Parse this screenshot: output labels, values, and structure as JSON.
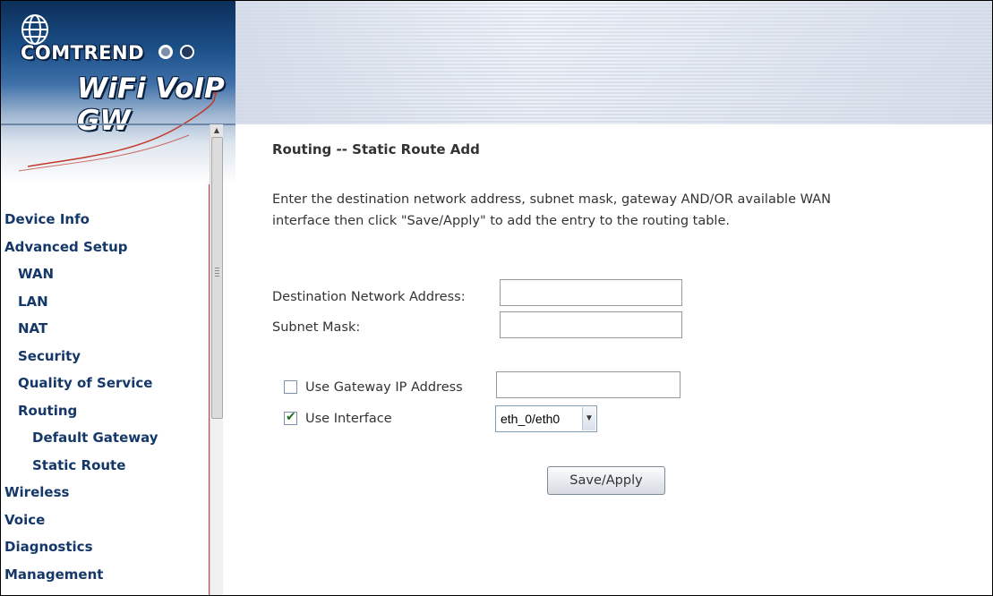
{
  "brand": {
    "company": "COMTREND",
    "product": "WiFi VoIP GW",
    "colors": {
      "primary": "#153868",
      "banner_light": "#dfe6ef"
    }
  },
  "sidebar": {
    "items": [
      {
        "label": "Device Info",
        "level": 0
      },
      {
        "label": "Advanced Setup",
        "level": 0
      },
      {
        "label": "WAN",
        "level": 1
      },
      {
        "label": "LAN",
        "level": 1
      },
      {
        "label": "NAT",
        "level": 1
      },
      {
        "label": "Security",
        "level": 1
      },
      {
        "label": "Quality of Service",
        "level": 1
      },
      {
        "label": "Routing",
        "level": 1
      },
      {
        "label": "Default Gateway",
        "level": 2
      },
      {
        "label": "Static Route",
        "level": 2
      },
      {
        "label": "Wireless",
        "level": 0
      },
      {
        "label": "Voice",
        "level": 0
      },
      {
        "label": "Diagnostics",
        "level": 0
      },
      {
        "label": "Management",
        "level": 0
      }
    ]
  },
  "page": {
    "title": "Routing -- Static Route Add",
    "description_line1": "Enter the destination network address, subnet mask, gateway AND/OR available WAN",
    "description_line2": "interface then click \"Save/Apply\" to add the entry to the routing table."
  },
  "form": {
    "dest_label": "Destination Network Address:",
    "dest_value": "",
    "mask_label": "Subnet Mask:",
    "mask_value": "",
    "gateway_label": "Use Gateway IP Address",
    "gateway_checked": false,
    "gateway_value": "",
    "interface_label": "Use Interface",
    "interface_checked": true,
    "interface_value": "eth_0/eth0",
    "save_label": "Save/Apply"
  },
  "icons": {
    "checkbox_check": "check-icon",
    "select_arrow": "chevron-down-icon"
  }
}
